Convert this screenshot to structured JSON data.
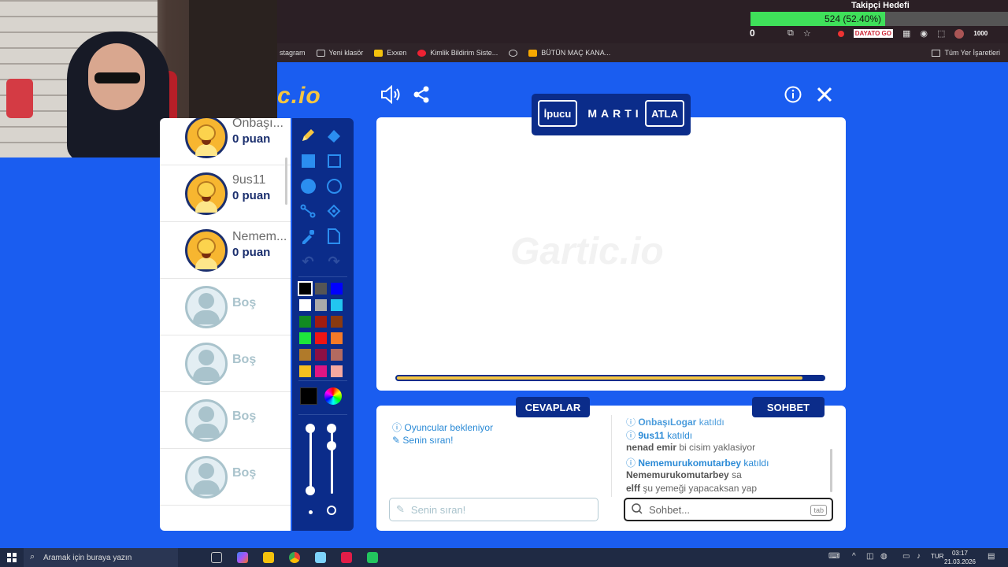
{
  "browser": {
    "bookmarks": [
      {
        "label": "stagram",
        "icon": "instagram-icon"
      },
      {
        "label": "Yeni klasör",
        "icon": "folder-icon"
      },
      {
        "label": "Exxen",
        "icon": "exxen-icon"
      },
      {
        "label": "Kimlik Bildirim Siste...",
        "icon": "pen-icon"
      },
      {
        "label": "",
        "icon": "globe-icon"
      },
      {
        "label": "BÜTÜN MAÇ KANA...",
        "icon": "jp-icon"
      }
    ],
    "all_bookmarks_label": "Tüm Yer İşaretleri"
  },
  "overlay": {
    "follower_goal_title": "Takipçi Hedefi",
    "follower_goal_label": "524 (52.40%)",
    "follower_goal_progress": 0.524,
    "counter": "0",
    "toolbar_chip": "DAYATO GO",
    "points_badge": "1000"
  },
  "game": {
    "logo_text": "c.io",
    "hint_button": "İpucu",
    "word": "MARTI",
    "skip_button": "ATLA",
    "watermark": "Gartic.io",
    "timer_progress": 0.95,
    "players": [
      {
        "name": "Onbaşı...",
        "score": "0 puan",
        "empty": false
      },
      {
        "name": "9us11",
        "score": "0 puan",
        "empty": false
      },
      {
        "name": "Nemem...",
        "score": "0 puan",
        "empty": false
      },
      {
        "name": "Boş",
        "score": "",
        "empty": true
      },
      {
        "name": "Boş",
        "score": "",
        "empty": true
      },
      {
        "name": "Boş",
        "score": "",
        "empty": true
      },
      {
        "name": "Boş",
        "score": "",
        "empty": true
      }
    ],
    "palette": [
      "#000000",
      "#555555",
      "#0000ff",
      "#ffffff",
      "#aaaaaa",
      "#22c6f0",
      "#118a22",
      "#a01c10",
      "#8a3a10",
      "#1ee63c",
      "#f01414",
      "#f57a28",
      "#b07a2a",
      "#8c0f44",
      "#b36a60",
      "#f5c020",
      "#e01583",
      "#f5a8a0"
    ],
    "answers_tab": "CEVAPLAR",
    "chat_tab": "SOHBET",
    "answers_messages": [
      {
        "text": "Oyuncular bekleniyor",
        "icon": "info-icon"
      },
      {
        "text": "Senin sıran!",
        "icon": "pencil-icon"
      }
    ],
    "chat_messages": [
      {
        "type": "info",
        "name": "OnbaşıLogar",
        "text": "katıldı"
      },
      {
        "type": "info",
        "name": "9us11",
        "text": "katıldı"
      },
      {
        "type": "chat",
        "name": "nenad emir",
        "text": "bi cisim yaklasiyor"
      },
      {
        "type": "info",
        "name": "Nememurukomutarbey",
        "text": "katıldı"
      },
      {
        "type": "chat",
        "name": "Nememurukomutarbey",
        "text": "sa"
      },
      {
        "type": "chat",
        "name": "elff",
        "text": "şu yemeği yapacaksan yap"
      }
    ],
    "answer_placeholder": "Senin sıran!",
    "chat_placeholder": "Sohbet...",
    "tab_key": "tab"
  },
  "taskbar": {
    "search_placeholder": "Aramak için buraya yazın",
    "language": "TUR",
    "time": "03:17",
    "date": "21.03.2026"
  }
}
